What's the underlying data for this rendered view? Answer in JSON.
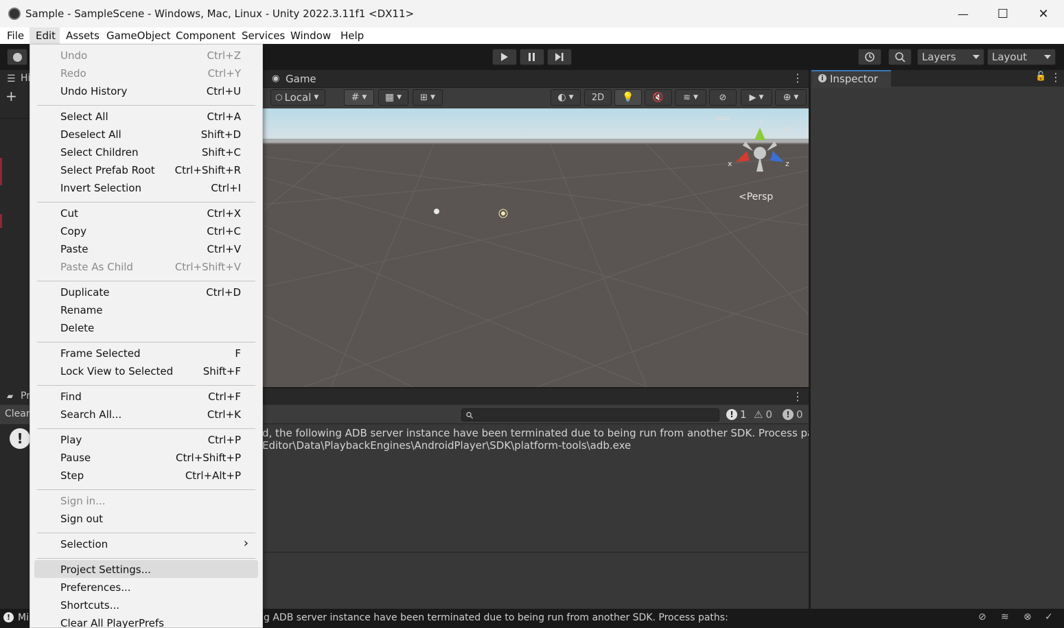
{
  "window": {
    "title": "Sample - SampleScene - Windows, Mac, Linux - Unity 2022.3.11f1 <DX11>",
    "minimize": "—",
    "maximize": "☐",
    "close": "✕"
  },
  "menubar": [
    "File",
    "Edit",
    "Assets",
    "GameObject",
    "Component",
    "Services",
    "Window",
    "Help"
  ],
  "toolbar": {
    "layers_label": "Layers",
    "layout_label": "Layout"
  },
  "scene": {
    "game_tab_label": "Game",
    "pivot_label": "Local",
    "toggle_2d_label": "2D",
    "persp_label": "Persp",
    "gizmo_axes": {
      "x": "x",
      "y": "y",
      "z": "z"
    }
  },
  "left_panels": {
    "hierarchy_tab_partial": "Hi",
    "project_tab_partial": "Pr",
    "clear_partial": "Clear"
  },
  "inspector": {
    "tab_label": "Inspector"
  },
  "console": {
    "error_count": "1",
    "warning_count": "0",
    "info_count": "0",
    "message_line1": "d, the following ADB server instance have been terminated due to being run from another SDK. Process paths:",
    "message_line2": "Editor\\Data\\PlaybackEngines\\AndroidPlayer\\SDK\\platform-tools\\adb.exe"
  },
  "statusbar": {
    "left_partial": "Mi",
    "message": "g ADB server instance have been terminated due to being run from another SDK. Process paths:"
  },
  "edit_menu": {
    "groups": [
      [
        {
          "label": "Undo",
          "shortcut": "Ctrl+Z",
          "disabled": true
        },
        {
          "label": "Redo",
          "shortcut": "Ctrl+Y",
          "disabled": true
        },
        {
          "label": "Undo History",
          "shortcut": "Ctrl+U",
          "disabled": false
        }
      ],
      [
        {
          "label": "Select All",
          "shortcut": "Ctrl+A",
          "disabled": false
        },
        {
          "label": "Deselect All",
          "shortcut": "Shift+D",
          "disabled": false
        },
        {
          "label": "Select Children",
          "shortcut": "Shift+C",
          "disabled": false
        },
        {
          "label": "Select Prefab Root",
          "shortcut": "Ctrl+Shift+R",
          "disabled": false
        },
        {
          "label": "Invert Selection",
          "shortcut": "Ctrl+I",
          "disabled": false
        }
      ],
      [
        {
          "label": "Cut",
          "shortcut": "Ctrl+X",
          "disabled": false
        },
        {
          "label": "Copy",
          "shortcut": "Ctrl+C",
          "disabled": false
        },
        {
          "label": "Paste",
          "shortcut": "Ctrl+V",
          "disabled": false
        },
        {
          "label": "Paste As Child",
          "shortcut": "Ctrl+Shift+V",
          "disabled": true
        }
      ],
      [
        {
          "label": "Duplicate",
          "shortcut": "Ctrl+D",
          "disabled": false
        },
        {
          "label": "Rename",
          "shortcut": "",
          "disabled": false
        },
        {
          "label": "Delete",
          "shortcut": "",
          "disabled": false
        }
      ],
      [
        {
          "label": "Frame Selected",
          "shortcut": "F",
          "disabled": false
        },
        {
          "label": "Lock View to Selected",
          "shortcut": "Shift+F",
          "disabled": false
        }
      ],
      [
        {
          "label": "Find",
          "shortcut": "Ctrl+F",
          "disabled": false
        },
        {
          "label": "Search All...",
          "shortcut": "Ctrl+K",
          "disabled": false
        }
      ],
      [
        {
          "label": "Play",
          "shortcut": "Ctrl+P",
          "disabled": false
        },
        {
          "label": "Pause",
          "shortcut": "Ctrl+Shift+P",
          "disabled": false
        },
        {
          "label": "Step",
          "shortcut": "Ctrl+Alt+P",
          "disabled": false
        }
      ],
      [
        {
          "label": "Sign in...",
          "shortcut": "",
          "disabled": true
        },
        {
          "label": "Sign out",
          "shortcut": "",
          "disabled": false
        }
      ],
      [
        {
          "label": "Selection",
          "shortcut": "›",
          "disabled": false
        }
      ],
      [
        {
          "label": "Project Settings...",
          "shortcut": "",
          "disabled": false,
          "highlighted": true
        },
        {
          "label": "Preferences...",
          "shortcut": "",
          "disabled": false
        },
        {
          "label": "Shortcuts...",
          "shortcut": "",
          "disabled": false
        },
        {
          "label": "Clear All PlayerPrefs",
          "shortcut": "",
          "disabled": false
        }
      ]
    ]
  },
  "colors": {
    "accent_blue": "#3a79bb",
    "scene_ground": "#5a5553",
    "sky_top": "#b9dbe8",
    "gizmo_x": "#d23b2f",
    "gizmo_y": "#8ccb3a",
    "gizmo_z": "#3a6fd6"
  }
}
